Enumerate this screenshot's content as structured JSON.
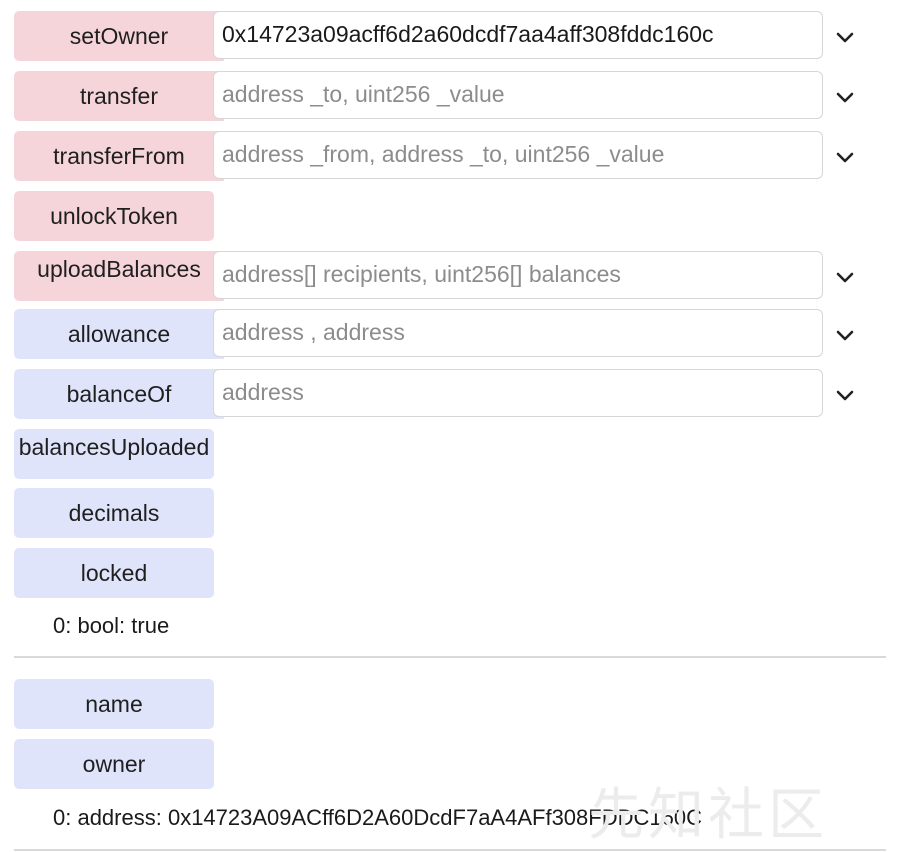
{
  "functions": {
    "setOwner": {
      "label": "setOwner",
      "value": "0x14723a09acff6d2a60dcdf7aa4aff308fddc160c"
    },
    "transfer": {
      "label": "transfer",
      "placeholder": "address _to, uint256 _value"
    },
    "transferFrom": {
      "label": "transferFrom",
      "placeholder": "address _from, address _to, uint256 _value"
    },
    "unlockToken": {
      "label": "unlockToken"
    },
    "uploadBalances": {
      "label": "uploadBalances",
      "placeholder": "address[] recipients, uint256[] balances"
    },
    "allowance": {
      "label": "allowance",
      "placeholder": "address , address"
    },
    "balanceOf": {
      "label": "balanceOf",
      "placeholder": "address"
    },
    "balancesUploaded": {
      "label": "balancesUploaded"
    },
    "decimals": {
      "label": "decimals"
    },
    "locked": {
      "label": "locked",
      "result": "0: bool: true"
    },
    "name": {
      "label": "name"
    },
    "owner": {
      "label": "owner",
      "result": "0: address: 0x14723A09ACff6D2A60DcdF7aA4AFf308FDDC160C"
    }
  },
  "colors": {
    "transact_button": "#f5d5d9",
    "call_button": "#dfe4fa"
  },
  "icons": {
    "expand": "chevron-down-icon"
  },
  "watermark": "先知社区"
}
